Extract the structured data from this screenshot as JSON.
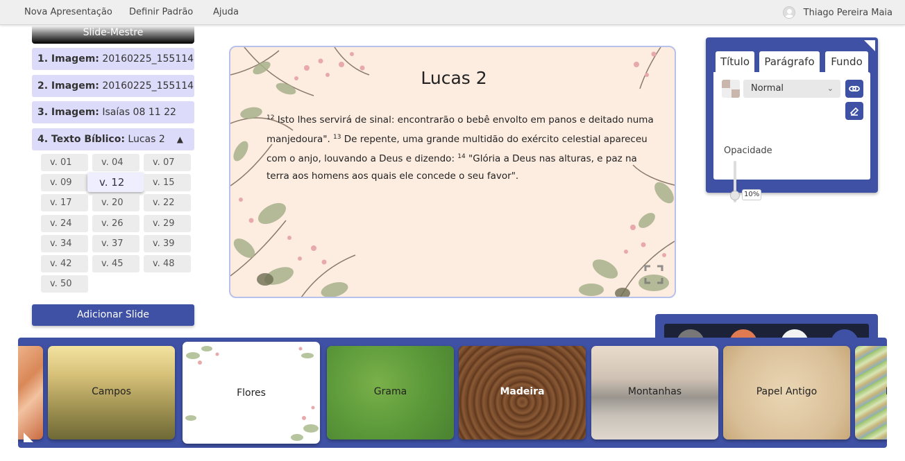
{
  "topbar": {
    "menu": [
      "Nova Apresentação",
      "Definir Padrão",
      "Ajuda"
    ],
    "user_name": "Thiago Pereira Maia"
  },
  "sidebar": {
    "master_label": "Slide-Mestre",
    "slides": [
      {
        "prefix": "1. Imagem:",
        "name": "20160225_155114"
      },
      {
        "prefix": "2. Imagem:",
        "name": "20160225_155114"
      },
      {
        "prefix": "3. Imagem:",
        "name": "Isaías 08 11 22"
      },
      {
        "prefix": "4. Texto Bíblico:",
        "name": "Lucas 2"
      }
    ],
    "verses": [
      "v. 01",
      "v. 04",
      "v. 07",
      "v. 09",
      "v. 12",
      "v. 15",
      "v. 17",
      "v. 20",
      "v. 22",
      "v. 24",
      "v. 26",
      "v. 29",
      "v. 34",
      "v. 37",
      "v. 39",
      "v. 42",
      "v. 45",
      "v. 48",
      "v. 50"
    ],
    "active_verse": "v. 12",
    "add_slide_label": "Adicionar Slide"
  },
  "preview": {
    "title": "Lucas 2",
    "verses": [
      {
        "num": "12",
        "text": " Isto lhes servirá de sinal: encontrarão o bebê envolto em panos e deitado numa manjedoura\". "
      },
      {
        "num": "13",
        "text": " De repente, uma grande multidão do exército celestial apareceu com o anjo, louvando a Deus e dizendo: "
      },
      {
        "num": "14",
        "text": " \"Glória a Deus nas alturas, e paz na terra aos homens aos quais ele concede o seu favor\"."
      }
    ]
  },
  "properties": {
    "tabs": [
      "Título",
      "Parágrafo",
      "Fundo"
    ],
    "active_tab": "Fundo",
    "blend_mode": "Normal",
    "opacity_label": "Opacidade",
    "opacity_value": "10%",
    "opacity_fraction": 0.1
  },
  "backgrounds": [
    "Campos",
    "Flores",
    "Grama",
    "Madeira",
    "Montanhas",
    "Papel Antigo",
    "P"
  ],
  "colors": {
    "accent": "#3f51a5",
    "slide_item_bg": "#dcdcfa",
    "preview_bg": "#fdece0"
  }
}
